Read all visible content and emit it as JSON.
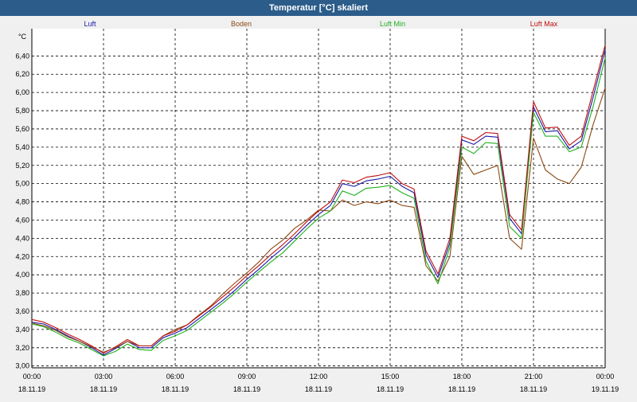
{
  "window": {
    "title": "Temperatur [°C] skaliert"
  },
  "chart_data": {
    "type": "line",
    "unit": "°C",
    "ylim": [
      2.98,
      6.56
    ],
    "yticks": [
      "3,00",
      "3,20",
      "3,40",
      "3,60",
      "3,80",
      "4,00",
      "4,20",
      "4,40",
      "4,60",
      "4,80",
      "5,00",
      "5,20",
      "5,40",
      "5,60",
      "5,80",
      "6,00",
      "6,20",
      "6,40"
    ],
    "ytick_values": [
      3.0,
      3.2,
      3.4,
      3.6,
      3.8,
      4.0,
      4.2,
      4.4,
      4.6,
      4.8,
      5.0,
      5.2,
      5.4,
      5.6,
      5.8,
      6.0,
      6.2,
      6.4
    ],
    "xticks": [
      {
        "time": "00:00",
        "date": "18.11.19"
      },
      {
        "time": "03:00",
        "date": "18.11.19"
      },
      {
        "time": "06:00",
        "date": "18.11.19"
      },
      {
        "time": "09:00",
        "date": "18.11.19"
      },
      {
        "time": "12:00",
        "date": "18.11.19"
      },
      {
        "time": "15:00",
        "date": "18.11.19"
      },
      {
        "time": "18:00",
        "date": "18.11.19"
      },
      {
        "time": "21:00",
        "date": "18.11.19"
      },
      {
        "time": "00:00",
        "date": "19.11.19"
      }
    ],
    "grid": true,
    "legend_placement": "top",
    "x_hours": [
      0,
      0.5,
      1,
      1.5,
      2,
      2.5,
      3,
      3.5,
      4,
      4.5,
      5,
      5.5,
      6,
      6.5,
      7,
      7.5,
      8,
      8.5,
      9,
      9.5,
      10,
      10.5,
      11,
      11.5,
      12,
      12.5,
      13,
      13.5,
      14,
      14.5,
      15,
      15.5,
      16,
      16.5,
      17,
      17.5,
      18,
      18.5,
      19,
      19.5,
      20,
      20.5,
      21,
      21.5,
      22,
      22.5,
      23,
      23.5,
      24
    ],
    "series": [
      {
        "name": "Luft",
        "color": "#1a1aa8",
        "values": [
          3.48,
          3.46,
          3.4,
          3.33,
          3.27,
          3.2,
          3.12,
          3.19,
          3.27,
          3.2,
          3.2,
          3.31,
          3.36,
          3.42,
          3.52,
          3.62,
          3.72,
          3.83,
          3.95,
          4.06,
          4.18,
          4.29,
          4.41,
          4.54,
          4.66,
          4.76,
          5.0,
          4.97,
          5.03,
          5.05,
          5.08,
          4.97,
          4.9,
          4.22,
          3.97,
          4.35,
          5.48,
          5.43,
          5.52,
          5.51,
          4.62,
          4.45,
          5.84,
          5.57,
          5.58,
          5.38,
          5.47,
          5.95,
          6.47
        ]
      },
      {
        "name": "Boden",
        "color": "#8b4a14",
        "values": [
          3.47,
          3.44,
          3.39,
          3.32,
          3.27,
          3.21,
          3.15,
          3.2,
          3.27,
          3.22,
          3.22,
          3.33,
          3.4,
          3.45,
          3.56,
          3.66,
          3.79,
          3.91,
          4.02,
          4.14,
          4.28,
          4.38,
          4.51,
          4.6,
          4.71,
          4.7,
          4.82,
          4.76,
          4.8,
          4.78,
          4.82,
          4.76,
          4.74,
          4.1,
          3.93,
          4.2,
          5.3,
          5.1,
          5.15,
          5.2,
          4.4,
          4.28,
          5.5,
          5.15,
          5.05,
          5.0,
          5.18,
          5.65,
          6.05
        ]
      },
      {
        "name": "Luft Min",
        "color": "#20b020",
        "values": [
          3.46,
          3.43,
          3.37,
          3.3,
          3.25,
          3.18,
          3.11,
          3.16,
          3.24,
          3.18,
          3.17,
          3.28,
          3.33,
          3.39,
          3.49,
          3.59,
          3.69,
          3.8,
          3.92,
          4.03,
          4.14,
          4.24,
          4.37,
          4.5,
          4.62,
          4.7,
          4.92,
          4.87,
          4.95,
          4.96,
          4.98,
          4.9,
          4.84,
          4.15,
          3.9,
          4.3,
          5.4,
          5.33,
          5.45,
          5.44,
          4.53,
          4.4,
          5.78,
          5.52,
          5.52,
          5.35,
          5.4,
          5.85,
          6.38
        ]
      },
      {
        "name": "Luft Max",
        "color": "#c01010",
        "values": [
          3.51,
          3.48,
          3.42,
          3.35,
          3.29,
          3.22,
          3.14,
          3.21,
          3.29,
          3.22,
          3.22,
          3.33,
          3.38,
          3.45,
          3.55,
          3.65,
          3.76,
          3.87,
          3.99,
          4.1,
          4.22,
          4.33,
          4.45,
          4.58,
          4.7,
          4.8,
          5.04,
          5.01,
          5.07,
          5.09,
          5.12,
          5.0,
          4.94,
          4.26,
          4.01,
          4.4,
          5.52,
          5.47,
          5.56,
          5.55,
          4.66,
          4.49,
          5.9,
          5.61,
          5.62,
          5.42,
          5.52,
          6.02,
          6.52
        ]
      }
    ]
  }
}
